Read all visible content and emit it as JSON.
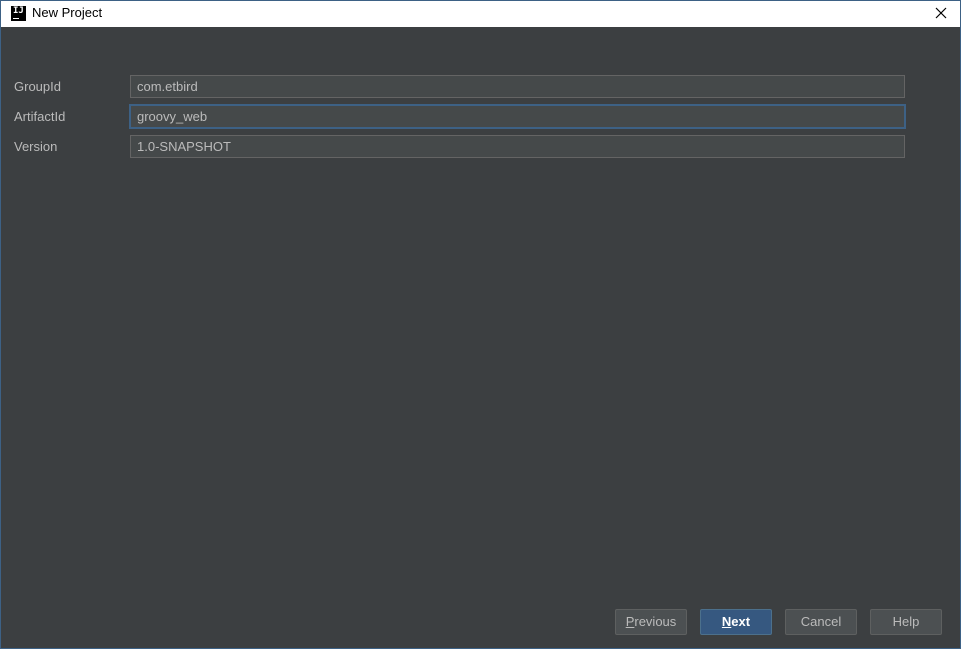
{
  "window": {
    "title": "New Project",
    "app_icon_text": "IJ"
  },
  "form": {
    "group_id": {
      "label": "GroupId",
      "value": "com.etbird"
    },
    "artifact_id": {
      "label": "ArtifactId",
      "value": "groovy_web"
    },
    "version": {
      "label": "Version",
      "value": "1.0-SNAPSHOT"
    }
  },
  "buttons": {
    "previous": {
      "mnemonic": "P",
      "rest": "revious"
    },
    "next": {
      "mnemonic": "N",
      "rest": "ext"
    },
    "cancel": "Cancel",
    "help": "Help"
  },
  "colors": {
    "background": "#3c3f41",
    "input_bg": "#45494a",
    "accent": "#365880",
    "focus_border": "#3d6185"
  }
}
